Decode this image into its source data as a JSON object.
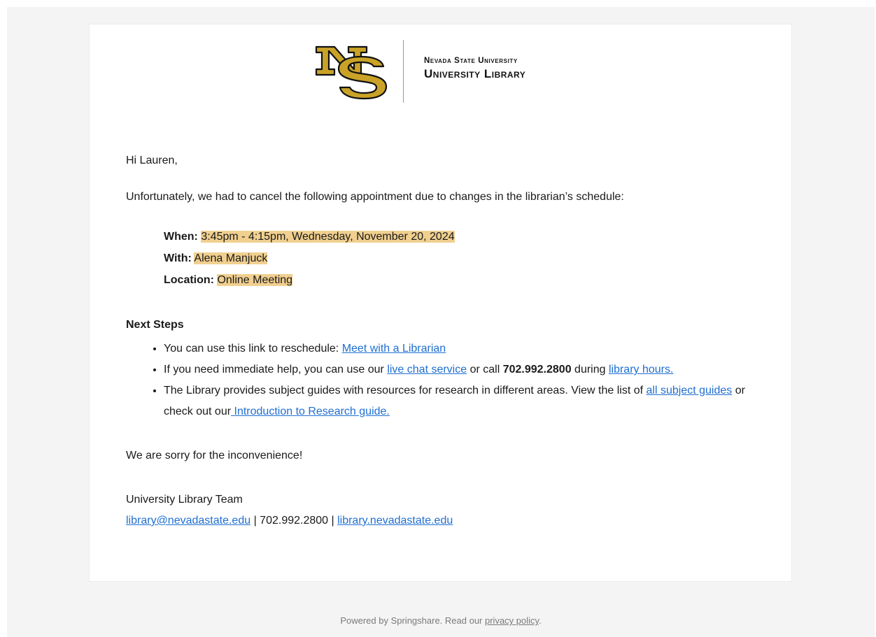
{
  "header": {
    "university_line": "Nevada State University",
    "library_line": "University Library",
    "brand_color": "#c9a227",
    "logo_icon": "ns-monogram-icon"
  },
  "email": {
    "greeting": "Hi Lauren,",
    "intro": "Unfortunately, we had to cancel the following appointment due to changes in the librarian’s schedule:",
    "details": {
      "when_label": "When:",
      "when_value": "3:45pm - 4:15pm, Wednesday, November 20, 2024",
      "with_label": "With:",
      "with_value": "Alena Manjuck",
      "location_label": "Location:",
      "location_value": "Online Meeting",
      "highlight_color": "#f0cf8f"
    },
    "next_steps_title": "Next Steps",
    "next_steps": {
      "item1_text": "You can use this link to reschedule: ",
      "item1_link": "Meet with a Librarian",
      "item2_text_a": "If you need immediate help, you can use our ",
      "item2_link1": "live chat service",
      "item2_text_b": " or call ",
      "item2_phone": "702.992.2800",
      "item2_text_c": " during ",
      "item2_link2": "library hours.",
      "item3_text_a": "The Library provides subject guides with resources for research in different areas. View the list of ",
      "item3_link1": "all subject guides",
      "item3_text_b": " or check out our",
      "item3_link2": " Introduction to Research guide."
    },
    "sorry": "We are sorry for the inconvenience!",
    "signature": {
      "team": "University Library Team",
      "email_link": "library@nevadastate.edu",
      "sep1": " | 702.992.2800 | ",
      "site_link": "library.nevadastate.edu"
    }
  },
  "footer": {
    "text": "Powered by Springshare. Read our ",
    "privacy_link": "privacy policy",
    "period": "."
  },
  "colors": {
    "link": "#1f6fd1",
    "page_bg": "#f4f4f4",
    "card_bg": "#ffffff"
  }
}
